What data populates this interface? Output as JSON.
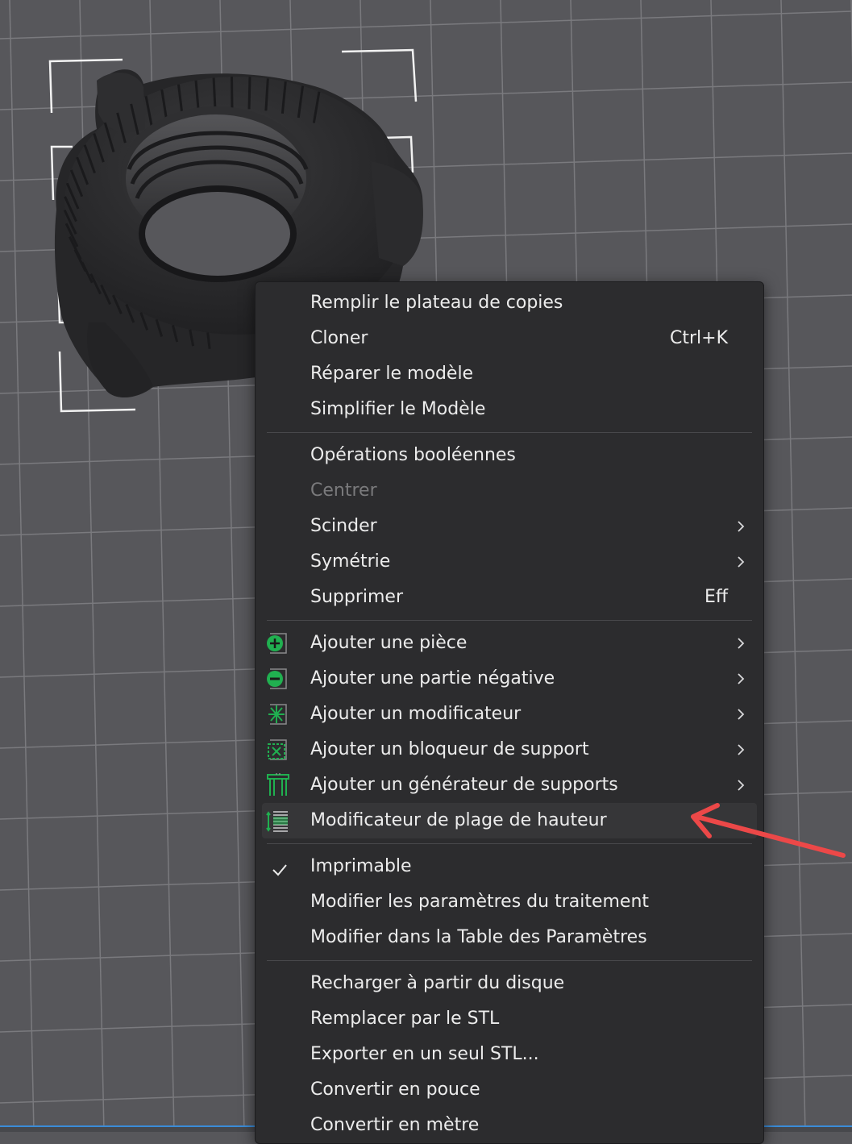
{
  "app": {
    "viewport": {
      "background": "#57575b",
      "grid_color": "#7a7a7e",
      "selected_object": "threaded-knob-nut"
    }
  },
  "context_menu": {
    "groups": [
      [
        {
          "label": "Remplir le plateau de copies",
          "shortcut": "",
          "submenu": false,
          "icon": "",
          "checked": false,
          "disabled": false
        },
        {
          "label": "Cloner",
          "shortcut": "Ctrl+K",
          "submenu": false,
          "icon": "",
          "checked": false,
          "disabled": false
        },
        {
          "label": "Réparer le modèle",
          "shortcut": "",
          "submenu": false,
          "icon": "",
          "checked": false,
          "disabled": false
        },
        {
          "label": "Simplifier le Modèle",
          "shortcut": "",
          "submenu": false,
          "icon": "",
          "checked": false,
          "disabled": false
        }
      ],
      [
        {
          "label": "Opérations booléennes",
          "shortcut": "",
          "submenu": false,
          "icon": "",
          "checked": false,
          "disabled": false
        },
        {
          "label": "Centrer",
          "shortcut": "",
          "submenu": false,
          "icon": "",
          "checked": false,
          "disabled": true
        },
        {
          "label": "Scinder",
          "shortcut": "",
          "submenu": true,
          "icon": "",
          "checked": false,
          "disabled": false
        },
        {
          "label": "Symétrie",
          "shortcut": "",
          "submenu": true,
          "icon": "",
          "checked": false,
          "disabled": false
        },
        {
          "label": "Supprimer",
          "shortcut": "Eff",
          "submenu": false,
          "icon": "",
          "checked": false,
          "disabled": false
        }
      ],
      [
        {
          "label": "Ajouter une pièce",
          "shortcut": "",
          "submenu": true,
          "icon": "add-part-icon",
          "checked": false,
          "disabled": false
        },
        {
          "label": "Ajouter une partie négative",
          "shortcut": "",
          "submenu": true,
          "icon": "add-negative-part-icon",
          "checked": false,
          "disabled": false
        },
        {
          "label": "Ajouter un modificateur",
          "shortcut": "",
          "submenu": true,
          "icon": "add-modifier-icon",
          "checked": false,
          "disabled": false
        },
        {
          "label": "Ajouter un bloqueur de support",
          "shortcut": "",
          "submenu": true,
          "icon": "support-blocker-icon",
          "checked": false,
          "disabled": false
        },
        {
          "label": "Ajouter un générateur de supports",
          "shortcut": "",
          "submenu": true,
          "icon": "support-enforcer-icon",
          "checked": false,
          "disabled": false
        },
        {
          "label": "Modificateur de plage de hauteur",
          "shortcut": "",
          "submenu": false,
          "icon": "height-range-modifier-icon",
          "checked": false,
          "disabled": false,
          "hovered": true
        }
      ],
      [
        {
          "label": "Imprimable",
          "shortcut": "",
          "submenu": false,
          "icon": "",
          "checked": true,
          "disabled": false
        },
        {
          "label": "Modifier les paramètres du traitement",
          "shortcut": "",
          "submenu": false,
          "icon": "",
          "checked": false,
          "disabled": false
        },
        {
          "label": "Modifier dans la Table des Paramètres",
          "shortcut": "",
          "submenu": false,
          "icon": "",
          "checked": false,
          "disabled": false
        }
      ],
      [
        {
          "label": "Recharger à partir du disque",
          "shortcut": "",
          "submenu": false,
          "icon": "",
          "checked": false,
          "disabled": false
        },
        {
          "label": "Remplacer par le STL",
          "shortcut": "",
          "submenu": false,
          "icon": "",
          "checked": false,
          "disabled": false
        },
        {
          "label": "Exporter en un seul STL...",
          "shortcut": "",
          "submenu": false,
          "icon": "",
          "checked": false,
          "disabled": false
        },
        {
          "label": "Convertir en pouce",
          "shortcut": "",
          "submenu": false,
          "icon": "",
          "checked": false,
          "disabled": false
        },
        {
          "label": "Convertir en mètre",
          "shortcut": "",
          "submenu": false,
          "icon": "",
          "checked": false,
          "disabled": false
        }
      ]
    ]
  },
  "colors": {
    "menu_bg": "#2c2c2e",
    "menu_text": "#ececec",
    "menu_disabled_text": "#7a7a7c",
    "icon_accent": "#20b050",
    "annotation_arrow": "#ec4848",
    "model": "#2a2a2c"
  }
}
